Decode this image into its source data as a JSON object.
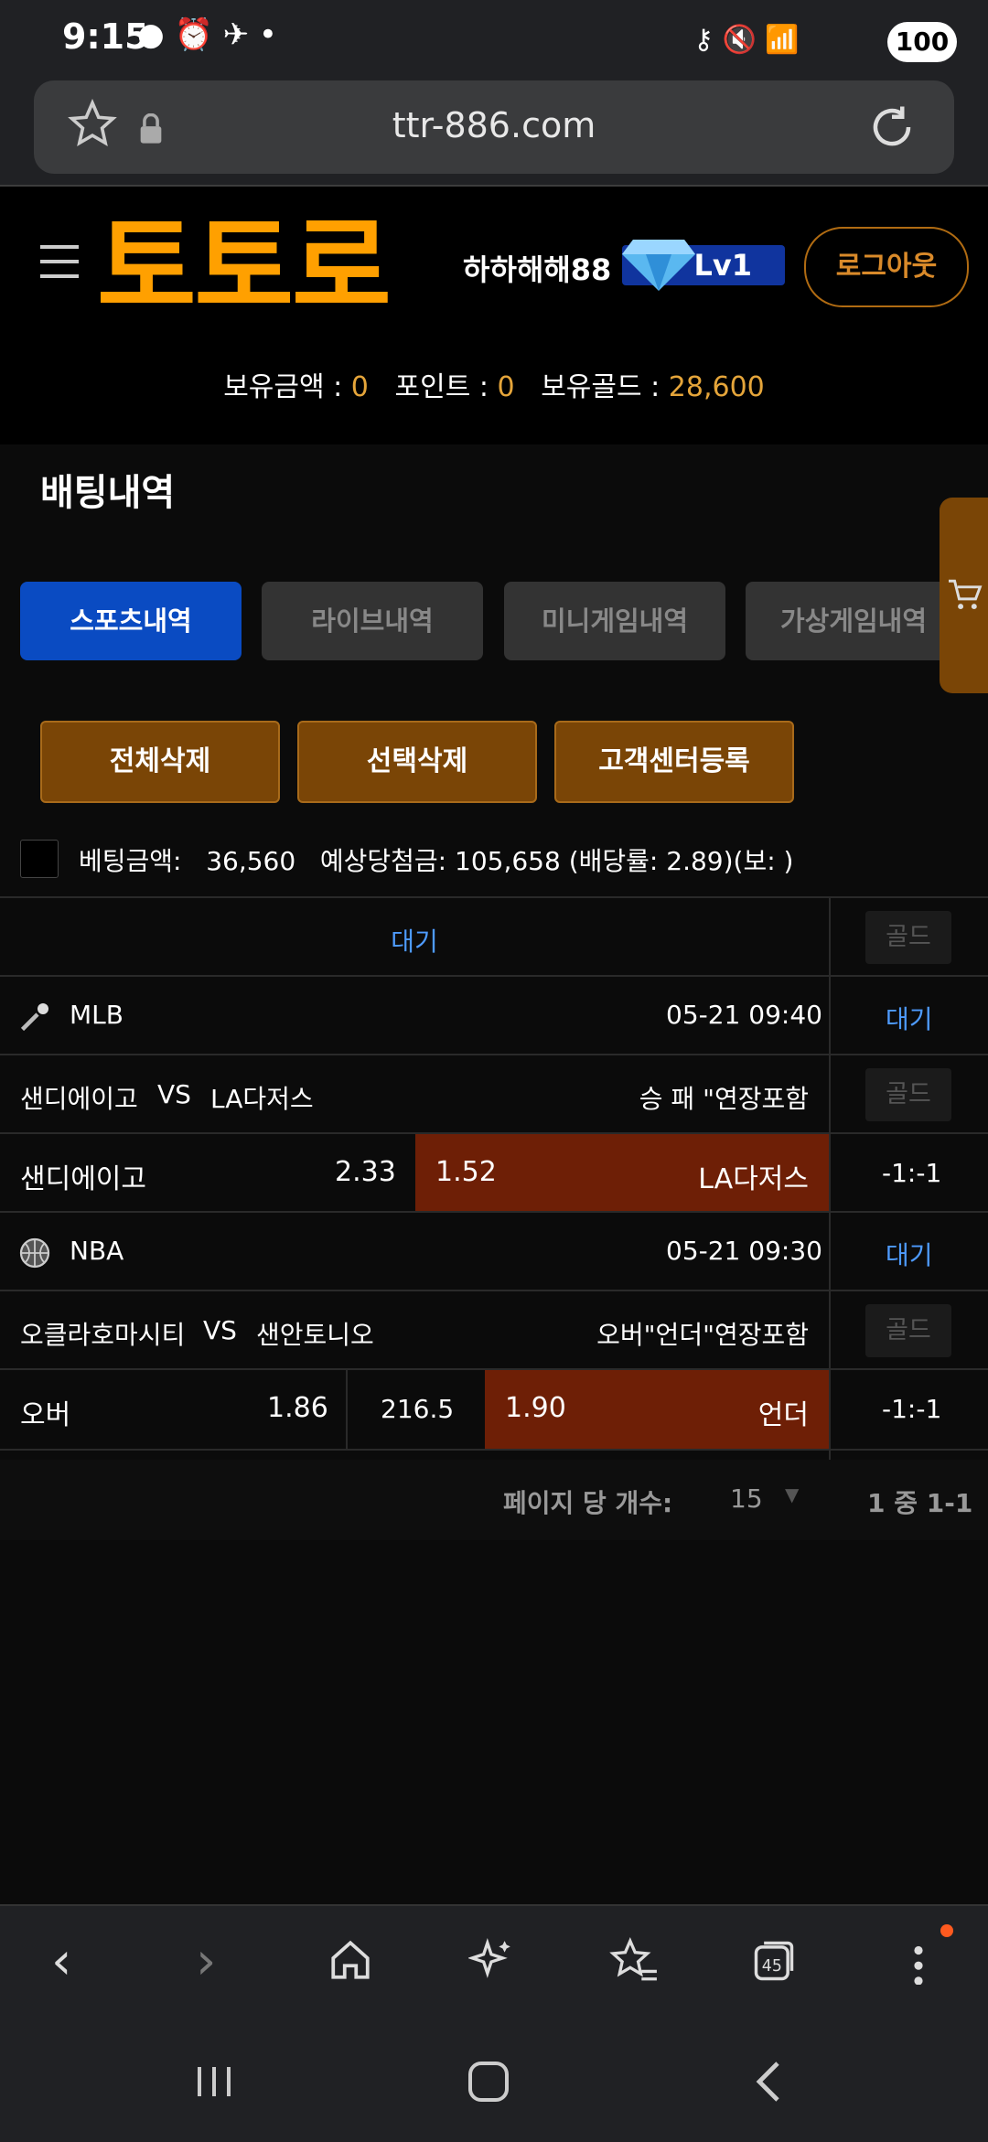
{
  "status_bar": {
    "time": "9:15",
    "battery": "100",
    "icons": "● ⏰ ✈ •"
  },
  "browser": {
    "url": "ttr-886.com"
  },
  "header": {
    "logo": "토토로",
    "username": "하하해해88",
    "level": "Lv1",
    "logout_label": "로그아웃",
    "balance_label": "보유금액 :",
    "balance_value": "0",
    "point_label": "포인트 :",
    "point_value": "0",
    "gold_label": "보유골드 :",
    "gold_value": "28,600"
  },
  "page": {
    "title": "배팅내역"
  },
  "tabs": [
    {
      "label": "스포츠내역",
      "active": true
    },
    {
      "label": "라이브내역",
      "active": false
    },
    {
      "label": "미니게임내역",
      "active": false
    },
    {
      "label": "가상게임내역",
      "active": false
    }
  ],
  "actions": {
    "delete_all": "전체삭제",
    "delete_selected": "선택삭제",
    "register_cs": "고객센터등록"
  },
  "summary": {
    "bet_label": "베팅금액:",
    "bet_value": "36,560",
    "expected_label": "예상당첨금:",
    "expected_value": "105,658",
    "odds_text": "(배당률: 2.89)(보: )"
  },
  "slip": {
    "status": "대기",
    "gold_label": "골드",
    "games": [
      {
        "league": "MLB",
        "time": "05-21 09:40",
        "status": "대기",
        "home": "샌디에이고",
        "vs": "VS",
        "away": "LA다저스",
        "market": "승 패 \"연장포함",
        "gold_label": "골드",
        "pick_left": "샌디에이고",
        "odd_left": "2.33",
        "odd_right": "1.52",
        "pick_right": "LA다저스",
        "score": "-1:-1"
      },
      {
        "league": "NBA",
        "time": "05-21 09:30",
        "status": "대기",
        "home": "오클라호마시티",
        "vs": "VS",
        "away": "샌안토니오",
        "market": "오버\"언더\"연장포함",
        "gold_label": "골드",
        "pick_left": "오버",
        "odd_left": "1.86",
        "line": "216.5",
        "odd_right": "1.90",
        "pick_right": "언더",
        "score": "-1:-1"
      }
    ]
  },
  "pager": {
    "per_page_label": "페이지 당 개수:",
    "per_page_value": "15",
    "range": "1 중 1-1"
  }
}
